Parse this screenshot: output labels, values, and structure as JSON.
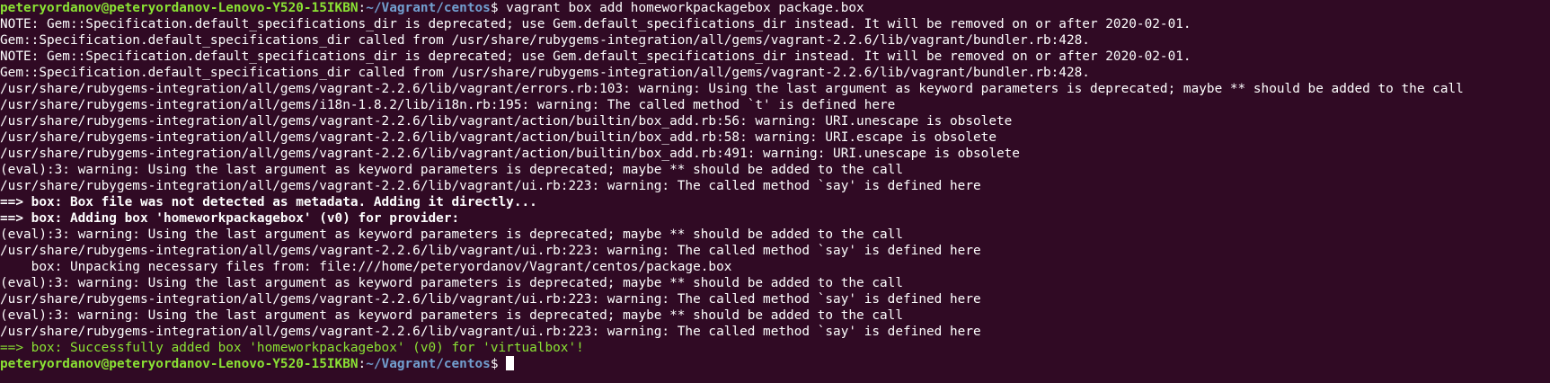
{
  "prompt": {
    "user_host": "peteryordanov@peteryordanov-Lenovo-Y520-15IKBN",
    "colon": ":",
    "path": "~/Vagrant/centos",
    "dollar": "$ "
  },
  "command": "vagrant box add homeworkpackagebox package.box",
  "output_lines": [
    {
      "text": "NOTE: Gem::Specification.default_specifications_dir is deprecated; use Gem.default_specifications_dir instead. It will be removed on or after 2020-02-01.",
      "style": "normal"
    },
    {
      "text": "Gem::Specification.default_specifications_dir called from /usr/share/rubygems-integration/all/gems/vagrant-2.2.6/lib/vagrant/bundler.rb:428.",
      "style": "normal"
    },
    {
      "text": "NOTE: Gem::Specification.default_specifications_dir is deprecated; use Gem.default_specifications_dir instead. It will be removed on or after 2020-02-01.",
      "style": "normal"
    },
    {
      "text": "Gem::Specification.default_specifications_dir called from /usr/share/rubygems-integration/all/gems/vagrant-2.2.6/lib/vagrant/bundler.rb:428.",
      "style": "normal"
    },
    {
      "text": "/usr/share/rubygems-integration/all/gems/vagrant-2.2.6/lib/vagrant/errors.rb:103: warning: Using the last argument as keyword parameters is deprecated; maybe ** should be added to the call",
      "style": "normal"
    },
    {
      "text": "/usr/share/rubygems-integration/all/gems/i18n-1.8.2/lib/i18n.rb:195: warning: The called method `t' is defined here",
      "style": "normal"
    },
    {
      "text": "/usr/share/rubygems-integration/all/gems/vagrant-2.2.6/lib/vagrant/action/builtin/box_add.rb:56: warning: URI.unescape is obsolete",
      "style": "normal"
    },
    {
      "text": "/usr/share/rubygems-integration/all/gems/vagrant-2.2.6/lib/vagrant/action/builtin/box_add.rb:58: warning: URI.escape is obsolete",
      "style": "normal"
    },
    {
      "text": "/usr/share/rubygems-integration/all/gems/vagrant-2.2.6/lib/vagrant/action/builtin/box_add.rb:491: warning: URI.unescape is obsolete",
      "style": "normal"
    },
    {
      "text": "(eval):3: warning: Using the last argument as keyword parameters is deprecated; maybe ** should be added to the call",
      "style": "normal"
    },
    {
      "text": "/usr/share/rubygems-integration/all/gems/vagrant-2.2.6/lib/vagrant/ui.rb:223: warning: The called method `say' is defined here",
      "style": "normal"
    },
    {
      "text": "==> box: Box file was not detected as metadata. Adding it directly...",
      "style": "bold"
    },
    {
      "text": "==> box: Adding box 'homeworkpackagebox' (v0) for provider:",
      "style": "bold"
    },
    {
      "text": "(eval):3: warning: Using the last argument as keyword parameters is deprecated; maybe ** should be added to the call",
      "style": "normal"
    },
    {
      "text": "/usr/share/rubygems-integration/all/gems/vagrant-2.2.6/lib/vagrant/ui.rb:223: warning: The called method `say' is defined here",
      "style": "normal"
    },
    {
      "text": "    box: Unpacking necessary files from: file:///home/peteryordanov/Vagrant/centos/package.box",
      "style": "normal"
    },
    {
      "text": "(eval):3: warning: Using the last argument as keyword parameters is deprecated; maybe ** should be added to the call",
      "style": "normal"
    },
    {
      "text": "/usr/share/rubygems-integration/all/gems/vagrant-2.2.6/lib/vagrant/ui.rb:223: warning: The called method `say' is defined here",
      "style": "normal"
    },
    {
      "text": "(eval):3: warning: Using the last argument as keyword parameters is deprecated; maybe ** should be added to the call",
      "style": "normal"
    },
    {
      "text": "/usr/share/rubygems-integration/all/gems/vagrant-2.2.6/lib/vagrant/ui.rb:223: warning: The called method `say' is defined here",
      "style": "normal"
    },
    {
      "text": "==> box: Successfully added box 'homeworkpackagebox' (v0) for 'virtualbox'!",
      "style": "green"
    }
  ],
  "colors": {
    "background": "#300a24",
    "text": "#ffffff",
    "user_host": "#8ae234",
    "path": "#729fcf",
    "success": "#8ae234"
  }
}
